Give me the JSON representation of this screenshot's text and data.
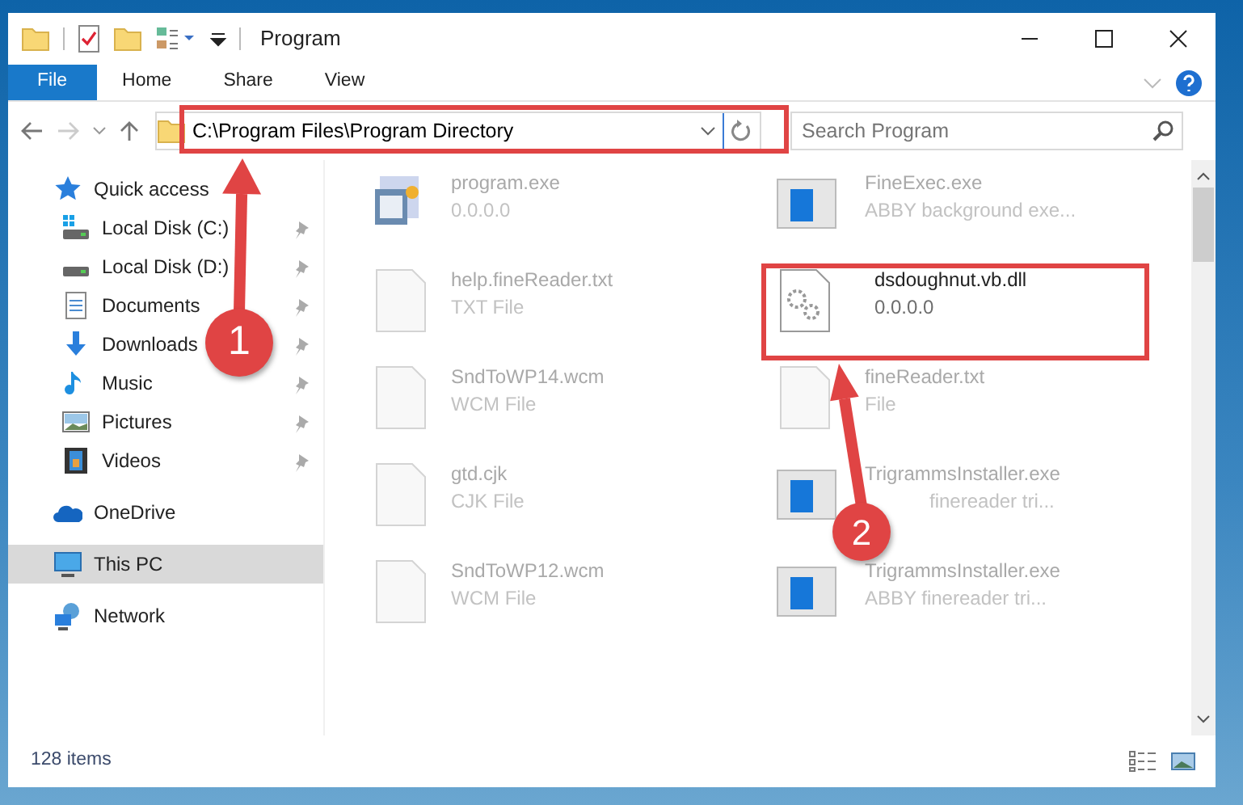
{
  "window": {
    "title": "Program"
  },
  "ribbon_tabs": [
    {
      "label": "File",
      "selected": true
    },
    {
      "label": "Home",
      "selected": false
    },
    {
      "label": "Share",
      "selected": false
    },
    {
      "label": "View",
      "selected": false
    }
  ],
  "address": {
    "path": "C:\\Program Files\\Program Directory"
  },
  "search": {
    "placeholder": "Search Program"
  },
  "sidebar": {
    "items": [
      {
        "label": "Quick access",
        "kind": "star",
        "selected": false,
        "children": [
          {
            "label": "Local Disk (C:)",
            "kind": "drive-win",
            "pinned": true,
            "selected": false
          },
          {
            "label": "Local Disk (D:)",
            "kind": "drive",
            "pinned": true,
            "selected": false
          },
          {
            "label": "Documents",
            "kind": "doc",
            "pinned": true,
            "selected": false
          },
          {
            "label": "Downloads",
            "kind": "download",
            "pinned": true,
            "selected": false
          },
          {
            "label": "Music",
            "kind": "music",
            "pinned": true,
            "selected": false
          },
          {
            "label": "Pictures",
            "kind": "pictures",
            "pinned": true,
            "selected": false
          },
          {
            "label": "Videos",
            "kind": "videos",
            "pinned": true,
            "selected": false
          }
        ]
      },
      {
        "label": "OneDrive",
        "kind": "cloud",
        "selected": false
      },
      {
        "label": "This PC",
        "kind": "pc",
        "selected": true
      },
      {
        "label": "Network",
        "kind": "network",
        "selected": false
      }
    ]
  },
  "files": [
    {
      "name": "program.exe",
      "detail": "0.0.0.0",
      "kind": "setup",
      "highlighted": false
    },
    {
      "name": "FineExec.exe",
      "detail": "ABBY background exe...",
      "kind": "app",
      "highlighted": false
    },
    {
      "name": "help.fineReader.txt",
      "detail": "TXT File",
      "kind": "blank",
      "highlighted": false
    },
    {
      "name": "dsdoughnut.vb.dll",
      "detail": "0.0.0.0",
      "kind": "dll",
      "highlighted": true
    },
    {
      "name": "SndToWP14.wcm",
      "detail": "WCM File",
      "kind": "blank",
      "highlighted": false
    },
    {
      "name": "fineReader.txt",
      "detail": "File",
      "kind": "blank",
      "highlighted": false
    },
    {
      "name": "gtd.cjk",
      "detail": "CJK File",
      "kind": "blank",
      "highlighted": false
    },
    {
      "name": "TrigrammsInstaller.exe",
      "detail": "finereader tri...",
      "kind": "app",
      "highlighted": false
    },
    {
      "name": "SndToWP12.wcm",
      "detail": "WCM File",
      "kind": "blank",
      "highlighted": false
    },
    {
      "name": "TrigrammsInstaller.exe",
      "detail": "ABBY finereader tri...",
      "kind": "app",
      "highlighted": false
    }
  ],
  "status_bar": {
    "item_count": "128 items"
  },
  "annotations": [
    {
      "label": "1"
    },
    {
      "label": "2"
    }
  ]
}
